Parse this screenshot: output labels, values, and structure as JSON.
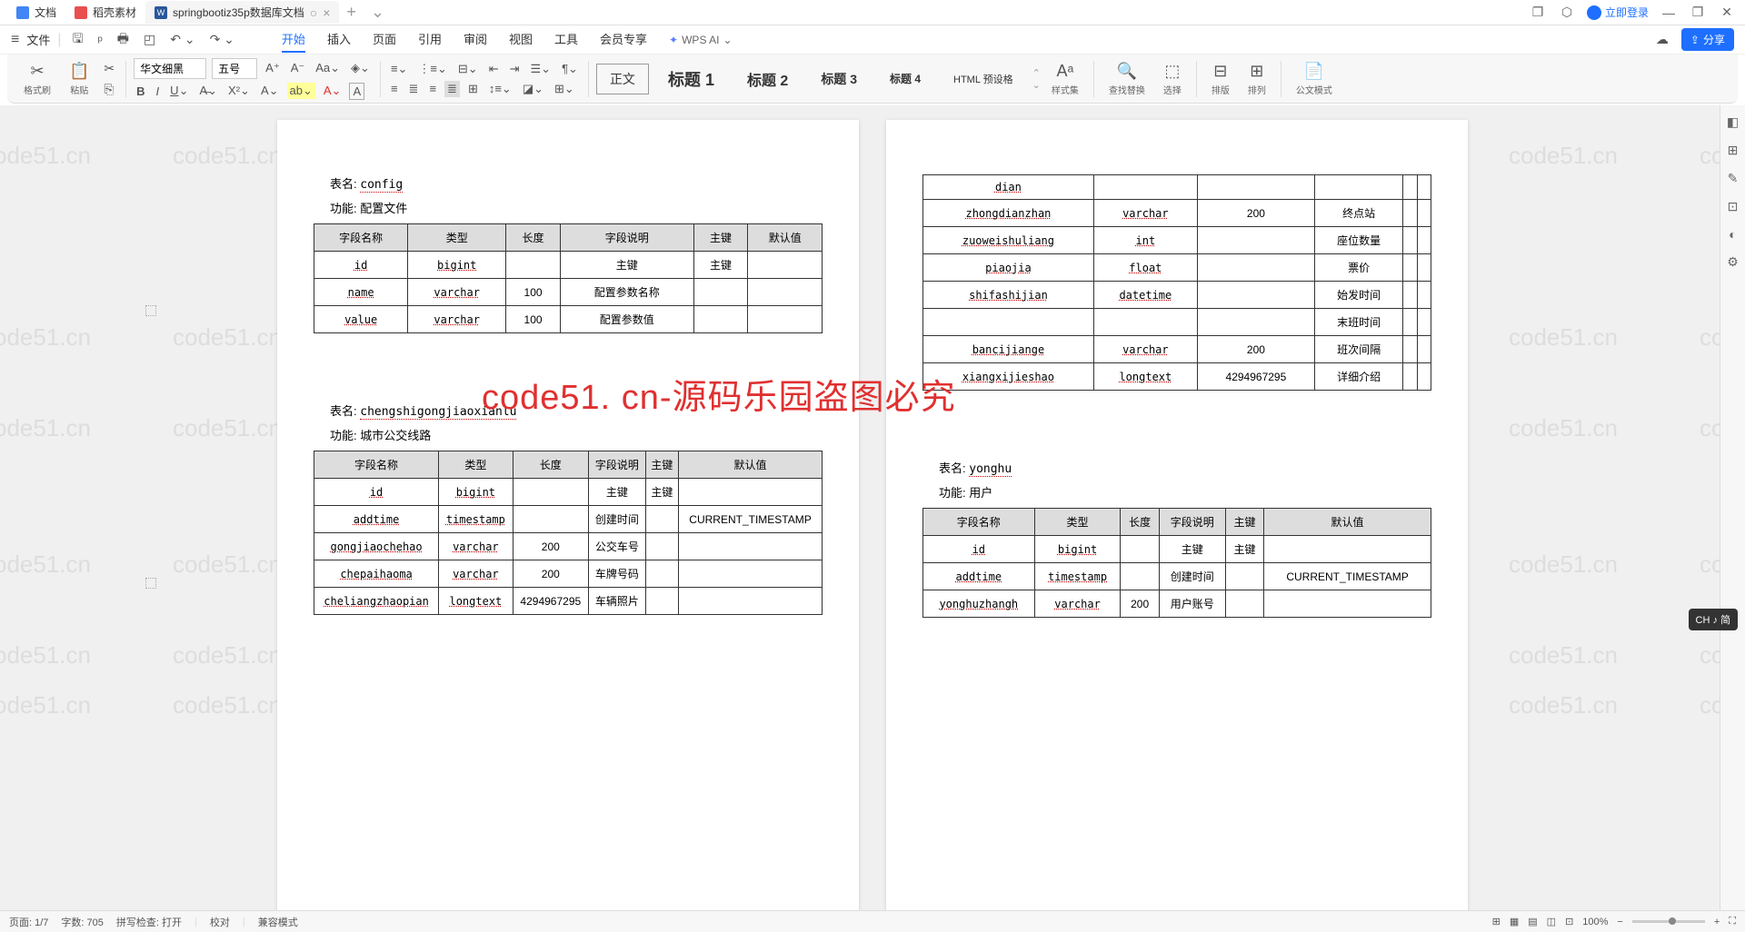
{
  "tabs": {
    "t1": "文档",
    "t2": "稻壳素材",
    "t3": "springbootiz35p数据库文档"
  },
  "login": "立即登录",
  "file_label": "文件",
  "menu": {
    "start": "开始",
    "insert": "插入",
    "page": "页面",
    "ref": "引用",
    "review": "审阅",
    "view": "视图",
    "tools": "工具",
    "vip": "会员专享",
    "ai": "WPS AI"
  },
  "share": "分享",
  "ribbon": {
    "format_painter": "格式刷",
    "paste": "粘贴",
    "font": "华文细黑",
    "size": "五号",
    "body": "正文",
    "h1": "标题 1",
    "h2": "标题 2",
    "h3": "标题 3",
    "h4": "标题 4",
    "html": "HTML 预设格",
    "styles": "样式集",
    "find": "查找替换",
    "select": "选择",
    "rows": "排版",
    "cols": "排列",
    "gov": "公文模式"
  },
  "ime": "CH ♪ 简",
  "status": {
    "page": "页面: 1/7",
    "words": "字数: 705",
    "spell": "拼写检查: 打开",
    "proof": "校对",
    "compat": "兼容模式",
    "zoom": "100%"
  },
  "watermark_text": "code51.cn",
  "watermark_red": "code51. cn-源码乐园盗图必究",
  "doc": {
    "headers": [
      "字段名称",
      "类型",
      "长度",
      "字段说明",
      "主键",
      "默认值"
    ],
    "label_table": "表名:",
    "label_func": "功能:",
    "sec1": {
      "name": "config",
      "func": "配置文件",
      "rows": [
        [
          "id",
          "bigint",
          "",
          "主键",
          "主键",
          ""
        ],
        [
          "name",
          "varchar",
          "100",
          "配置参数名称",
          "",
          ""
        ],
        [
          "value",
          "varchar",
          "100",
          "配置参数值",
          "",
          ""
        ]
      ]
    },
    "sec2": {
      "name": "chengshigongjiaoxianlu",
      "func": "城市公交线路",
      "rows": [
        [
          "id",
          "bigint",
          "",
          "主键",
          "主键",
          ""
        ],
        [
          "addtime",
          "timestamp",
          "",
          "创建时间",
          "",
          "CURRENT_TIMESTAMP"
        ],
        [
          "gongjiaochehao",
          "varchar",
          "200",
          "公交车号",
          "",
          ""
        ],
        [
          "chepaihaoma",
          "varchar",
          "200",
          "车牌号码",
          "",
          ""
        ],
        [
          "cheliangzhaopian",
          "longtext",
          "4294967295",
          "车辆照片",
          "",
          ""
        ]
      ]
    },
    "sec3": {
      "rows": [
        [
          "dian",
          "",
          "",
          "",
          "",
          ""
        ],
        [
          "zhongdianzhan",
          "varchar",
          "200",
          "终点站",
          "",
          ""
        ],
        [
          "zuoweishuliang",
          "int",
          "",
          "座位数量",
          "",
          ""
        ],
        [
          "piaojia",
          "float",
          "",
          "票价",
          "",
          ""
        ],
        [
          "shifashijian",
          "datetime",
          "",
          "始发时间",
          "",
          ""
        ],
        [
          "",
          "",
          "",
          "末班时间",
          "",
          ""
        ],
        [
          "bancijiange",
          "varchar",
          "200",
          "班次间隔",
          "",
          ""
        ],
        [
          "xiangxijieshao",
          "longtext",
          "4294967295",
          "详细介绍",
          "",
          ""
        ]
      ]
    },
    "sec4": {
      "name": "yonghu",
      "func": "用户",
      "rows": [
        [
          "id",
          "bigint",
          "",
          "主键",
          "主键",
          ""
        ],
        [
          "addtime",
          "timestamp",
          "",
          "创建时间",
          "",
          "CURRENT_TIMESTAMP"
        ],
        [
          "yonghuzhangh",
          "varchar",
          "200",
          "用户账号",
          "",
          ""
        ]
      ]
    }
  }
}
